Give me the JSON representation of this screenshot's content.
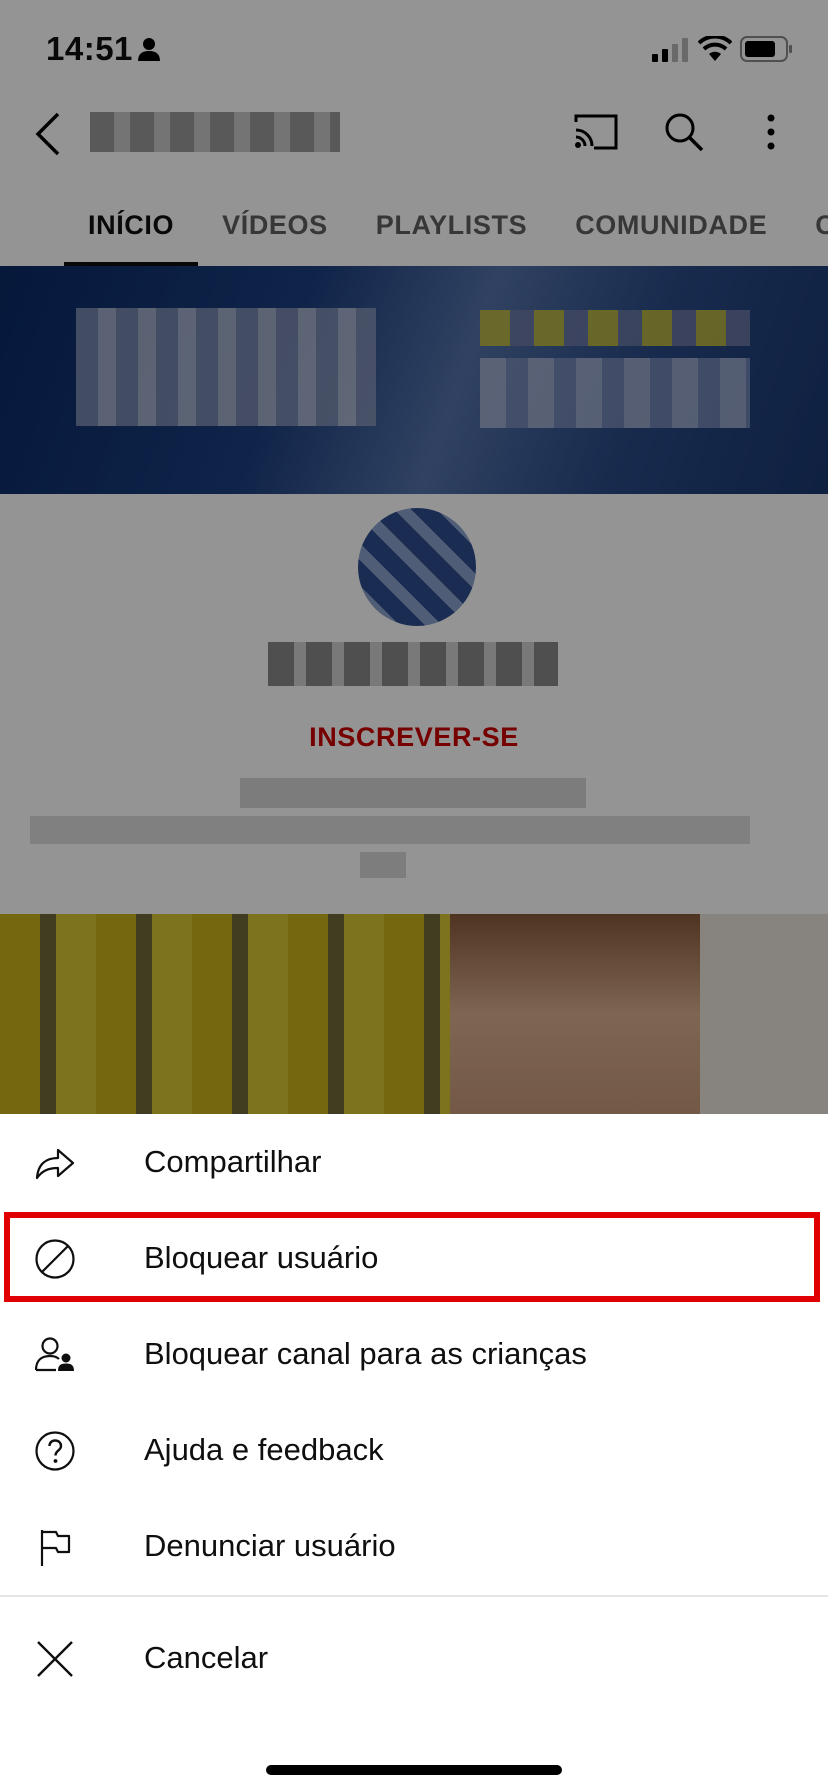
{
  "status_bar": {
    "time": "14:51"
  },
  "tabs": [
    {
      "label": "INÍCIO",
      "active": true
    },
    {
      "label": "VÍDEOS",
      "active": false
    },
    {
      "label": "PLAYLISTS",
      "active": false
    },
    {
      "label": "COMUNIDADE",
      "active": false
    },
    {
      "label": "C",
      "active": false
    }
  ],
  "channel": {
    "subscribe_label": "INSCREVER-SE"
  },
  "menu": {
    "items": [
      {
        "label": "Compartilhar",
        "icon": "share-icon"
      },
      {
        "label": "Bloquear usuário",
        "icon": "block-icon",
        "highlighted": true
      },
      {
        "label": "Bloquear canal para as crianças",
        "icon": "block-for-kids-icon"
      },
      {
        "label": "Ajuda e feedback",
        "icon": "help-icon"
      },
      {
        "label": "Denunciar usuário",
        "icon": "flag-icon"
      }
    ],
    "cancel_label": "Cancelar"
  },
  "colors": {
    "subscribe": "#cc0000",
    "highlight_border": "#e00000"
  }
}
